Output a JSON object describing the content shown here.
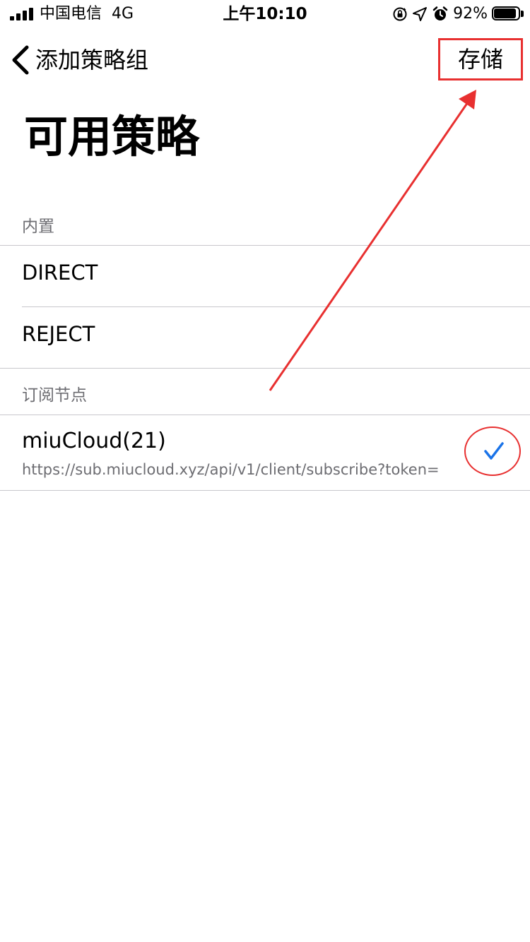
{
  "status_bar": {
    "carrier": "中国电信",
    "network": "4G",
    "time": "上午10:10",
    "battery_percent": "92%",
    "battery_level": 0.92
  },
  "nav": {
    "back_label": "添加策略组",
    "save_label": "存储"
  },
  "page_title": "可用策略",
  "sections": {
    "builtin": {
      "header": "内置",
      "items": [
        "DIRECT",
        "REJECT"
      ]
    },
    "subscription": {
      "header": "订阅节点",
      "item": {
        "title": "miuCloud(21)",
        "url": "https://sub.miucloud.xyz/api/v1/client/subscribe?token=",
        "selected": true
      }
    }
  },
  "icons": {
    "back": "chevron-left-icon",
    "check": "checkmark-icon",
    "orientation_lock": "orientation-lock-icon",
    "location": "location-arrow-icon",
    "alarm": "alarm-icon",
    "signal": "cellular-signal-icon",
    "battery": "battery-icon"
  },
  "colors": {
    "annotation_red": "#e83030",
    "check_blue": "#1a73e8",
    "secondary_text": "#6d6d72",
    "separator": "#c8c7cc"
  }
}
